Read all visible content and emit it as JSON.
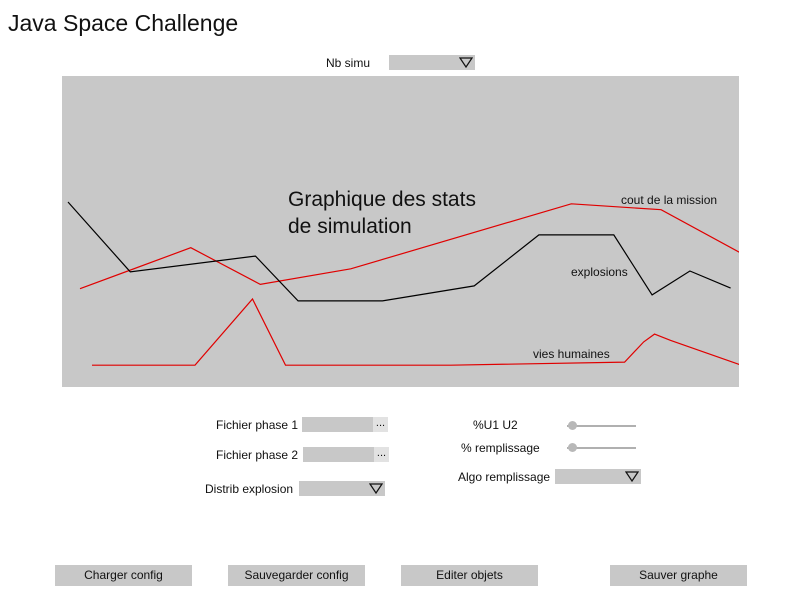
{
  "app": {
    "title": "Java Space Challenge"
  },
  "nb_simu": {
    "label": "Nb simu",
    "value": ""
  },
  "chart": {
    "title": "Graphique des stats\nde simulation",
    "labels": {
      "cout": "cout de la mission",
      "explosions": "explosions",
      "vies": "vies humaines"
    }
  },
  "chart_data": {
    "type": "line",
    "title": "Graphique des stats\nde simulation",
    "xlabel": "",
    "ylabel": "",
    "colors": {
      "cout": "#e00000",
      "explosions": "#000000",
      "vies": "#e00000"
    },
    "series": [
      {
        "name": "cout de la mission",
        "color": "#e00000",
        "x": [
          0,
          18.5,
          30.1,
          45.2,
          82.0,
          97.0,
          111.5
        ],
        "y": [
          31.6,
          44.8,
          33.0,
          38.0,
          58.9,
          57.0,
          41.8
        ]
      },
      {
        "name": "explosions",
        "color": "#000000",
        "x": [
          -2.0,
          8.4,
          29.3,
          36.4,
          50.5,
          65.8,
          76.6,
          89.1,
          95.5,
          101.8,
          108.6
        ],
        "y": [
          59.5,
          37.0,
          42.1,
          27.7,
          27.7,
          32.5,
          48.9,
          48.9,
          29.6,
          37.3,
          31.8
        ]
      },
      {
        "name": "vies humaines",
        "color": "#e00000",
        "x": [
          2.0,
          19.2,
          28.8,
          34.3,
          61.9,
          90.9,
          94.1,
          95.9,
          98.6,
          111.3
        ],
        "y": [
          7.0,
          7.0,
          28.3,
          7.0,
          7.0,
          8.0,
          14.5,
          17.0,
          15.0,
          6.4
        ]
      }
    ]
  },
  "form": {
    "fichier_phase1": {
      "label": "Fichier phase 1",
      "value": "",
      "browse": "..."
    },
    "fichier_phase2": {
      "label": "Fichier phase 2",
      "value": "",
      "browse": "..."
    },
    "distrib_explosion": {
      "label": "Distrib explosion",
      "value": ""
    },
    "u1u2": {
      "label": "%U1 U2",
      "value_fraction": 0.05
    },
    "remplissage": {
      "label": "% remplissage",
      "value_fraction": 0.05
    },
    "algo_remplissage": {
      "label": "Algo remplissage",
      "value": ""
    }
  },
  "buttons": {
    "charger": "Charger config",
    "sauvegarder": "Sauvegarder config",
    "editer": "Editer objets",
    "sauver_graphe": "Sauver graphe"
  }
}
